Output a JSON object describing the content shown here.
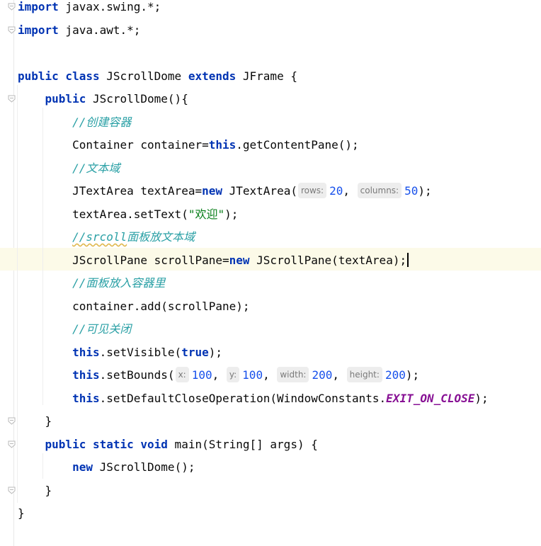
{
  "editor": {
    "lines": [
      {
        "tokens": [
          {
            "t": "import",
            "c": "kw"
          },
          {
            "t": " javax.swing.*;",
            "c": ""
          }
        ]
      },
      {
        "tokens": [
          {
            "t": "import",
            "c": "kw"
          },
          {
            "t": " java.awt.*;",
            "c": ""
          }
        ]
      },
      {
        "tokens": []
      },
      {
        "tokens": [
          {
            "t": "public class",
            "c": "kw"
          },
          {
            "t": " JScrollDome ",
            "c": ""
          },
          {
            "t": "extends",
            "c": "kw"
          },
          {
            "t": " JFrame {",
            "c": ""
          }
        ]
      },
      {
        "tokens": [
          {
            "t": "    ",
            "c": ""
          },
          {
            "t": "public",
            "c": "kw"
          },
          {
            "t": " JScrollDome(){",
            "c": ""
          }
        ]
      },
      {
        "tokens": [
          {
            "t": "        ",
            "c": ""
          },
          {
            "t": "//创建容器",
            "c": "cmt"
          }
        ]
      },
      {
        "tokens": [
          {
            "t": "        Container container=",
            "c": ""
          },
          {
            "t": "this",
            "c": "kw"
          },
          {
            "t": ".getContentPane();",
            "c": ""
          }
        ]
      },
      {
        "tokens": [
          {
            "t": "        ",
            "c": ""
          },
          {
            "t": "//文本域",
            "c": "cmt"
          }
        ]
      },
      {
        "tokens": [
          {
            "t": "        JTextArea textArea=",
            "c": ""
          },
          {
            "t": "new",
            "c": "kw"
          },
          {
            "t": " JTextArea(",
            "c": ""
          },
          {
            "t": "rows:",
            "c": "hint"
          },
          {
            "t": "20",
            "c": "num"
          },
          {
            "t": ", ",
            "c": ""
          },
          {
            "t": "columns:",
            "c": "hint"
          },
          {
            "t": "50",
            "c": "num"
          },
          {
            "t": ");",
            "c": ""
          }
        ]
      },
      {
        "tokens": [
          {
            "t": "        textArea.setText(",
            "c": ""
          },
          {
            "t": "\"欢迎\"",
            "c": "str"
          },
          {
            "t": ");",
            "c": ""
          }
        ]
      },
      {
        "tokens": [
          {
            "t": "        ",
            "c": ""
          },
          {
            "t": "//srcoll",
            "c": "cmt squig"
          },
          {
            "t": "面板放文本域",
            "c": "cmt"
          }
        ]
      },
      {
        "tokens": [
          {
            "t": "        JScrollPane scrollPane=",
            "c": ""
          },
          {
            "t": "new",
            "c": "kw"
          },
          {
            "t": " JScrollPane(textArea);",
            "c": ""
          },
          {
            "t": "",
            "c": "caret"
          }
        ]
      },
      {
        "tokens": [
          {
            "t": "        ",
            "c": ""
          },
          {
            "t": "//面板放入容器里",
            "c": "cmt"
          }
        ]
      },
      {
        "tokens": [
          {
            "t": "        container.add(scrollPane);",
            "c": ""
          }
        ]
      },
      {
        "tokens": [
          {
            "t": "        ",
            "c": ""
          },
          {
            "t": "//可见关闭",
            "c": "cmt"
          }
        ]
      },
      {
        "tokens": [
          {
            "t": "        ",
            "c": ""
          },
          {
            "t": "this",
            "c": "kw"
          },
          {
            "t": ".setVisible(",
            "c": ""
          },
          {
            "t": "true",
            "c": "kw"
          },
          {
            "t": ");",
            "c": ""
          }
        ]
      },
      {
        "tokens": [
          {
            "t": "        ",
            "c": ""
          },
          {
            "t": "this",
            "c": "kw"
          },
          {
            "t": ".setBounds(",
            "c": ""
          },
          {
            "t": "x:",
            "c": "hint"
          },
          {
            "t": "100",
            "c": "num"
          },
          {
            "t": ", ",
            "c": ""
          },
          {
            "t": "y:",
            "c": "hint"
          },
          {
            "t": "100",
            "c": "num"
          },
          {
            "t": ", ",
            "c": ""
          },
          {
            "t": "width:",
            "c": "hint"
          },
          {
            "t": "200",
            "c": "num"
          },
          {
            "t": ", ",
            "c": ""
          },
          {
            "t": "height:",
            "c": "hint"
          },
          {
            "t": "200",
            "c": "num"
          },
          {
            "t": ");",
            "c": ""
          }
        ]
      },
      {
        "tokens": [
          {
            "t": "        ",
            "c": ""
          },
          {
            "t": "this",
            "c": "kw"
          },
          {
            "t": ".setDefaultCloseOperation(WindowConstants.",
            "c": ""
          },
          {
            "t": "EXIT_ON_CLOSE",
            "c": "cst"
          },
          {
            "t": ");",
            "c": ""
          }
        ]
      },
      {
        "tokens": [
          {
            "t": "    }",
            "c": ""
          }
        ]
      },
      {
        "tokens": [
          {
            "t": "    ",
            "c": ""
          },
          {
            "t": "public static void",
            "c": "kw"
          },
          {
            "t": " main(String[] args) {",
            "c": ""
          }
        ]
      },
      {
        "tokens": [
          {
            "t": "        ",
            "c": ""
          },
          {
            "t": "new",
            "c": "kw"
          },
          {
            "t": " JScrollDome();",
            "c": ""
          }
        ]
      },
      {
        "tokens": [
          {
            "t": "    }",
            "c": ""
          }
        ]
      },
      {
        "tokens": [
          {
            "t": "}",
            "c": ""
          }
        ]
      }
    ],
    "folds": [
      0,
      1,
      4,
      18,
      19,
      21
    ],
    "current_line": 11
  }
}
